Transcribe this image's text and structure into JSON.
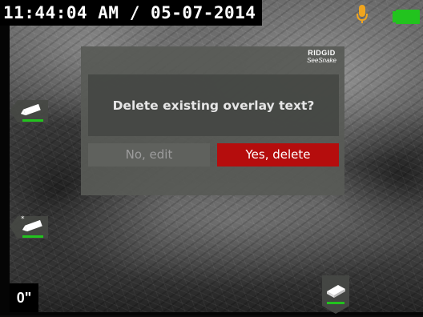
{
  "status_bar": {
    "timestamp": "11:44:04 AM / 05-07-2014",
    "mic_icon": "microphone-icon",
    "battery_icon": "battery-full-icon"
  },
  "dialog": {
    "brand_name": "RIDGID",
    "brand_product": "SeeSnake",
    "message": "Delete existing overlay text?",
    "no_label": "No, edit",
    "yes_label": "Yes, delete"
  },
  "side_controls": {
    "zoom_value": "0\"",
    "top_icon": "sonde-icon",
    "lower_icon": "sonde-star-icon",
    "bottom_icon": "eraser-icon"
  },
  "colors": {
    "yes_button": "#b50d0d",
    "indicator_green": "#22c31e",
    "mic_orange": "#f0a51e"
  }
}
